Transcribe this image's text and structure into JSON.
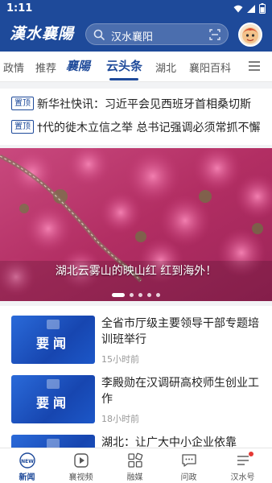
{
  "status_bar": {
    "time": "1:11"
  },
  "header": {
    "logo": "漢水襄陽",
    "search_text": "汉水襄阳"
  },
  "tabs": [
    {
      "label": "政情"
    },
    {
      "label": "推荐"
    },
    {
      "label": "襄陽"
    },
    {
      "label": "云头条"
    },
    {
      "label": "湖北"
    },
    {
      "label": "襄阳百科"
    }
  ],
  "pinned": [
    {
      "tag": "置顶",
      "text": "新华社快讯：习近平会见西班牙首相桑切斯"
    },
    {
      "tag": "置顶",
      "text": "†代的徙木立信之举 总书记强调必须常抓不懈"
    }
  ],
  "banner": {
    "caption": "湖北云雾山的映山红 红到海外！",
    "slide_count": 5,
    "active_slide": 1
  },
  "news": [
    {
      "thumb_label": "要闻",
      "title": "全省市厅级主要领导干部专题培训班举行",
      "time": "15小时前"
    },
    {
      "thumb_label": "要闻",
      "title": "李殿勋在汉调研高校师生创业工作",
      "time": "18小时前"
    },
    {
      "thumb_label": "",
      "title": "湖北：让广大中小企业依靠",
      "time": ""
    }
  ],
  "bottom_nav": [
    {
      "label": "新闻",
      "icon": "news-icon",
      "active": true
    },
    {
      "label": "襄视频",
      "icon": "video-icon",
      "active": false
    },
    {
      "label": "融媒",
      "icon": "media-grid-icon",
      "active": false
    },
    {
      "label": "问政",
      "icon": "chat-icon",
      "active": false
    },
    {
      "label": "汉水号",
      "icon": "subscription-icon",
      "active": false
    }
  ],
  "colors": {
    "brand_blue": "#1e4a9a",
    "azalea_pink": "#d63c7e",
    "notification_red": "#e53935"
  }
}
